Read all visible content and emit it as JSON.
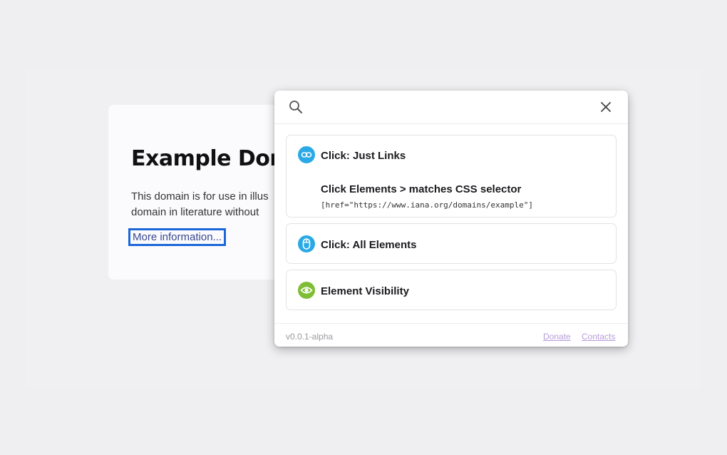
{
  "background_page": {
    "title": "Example Dom",
    "paragraph_lines": [
      "This domain is for use in illus",
      "domain in literature without"
    ],
    "link_label": "More information..."
  },
  "popup": {
    "search": {
      "placeholder": "",
      "value": ""
    },
    "actions": [
      {
        "label": "Click: Just Links",
        "icon": "link-icon",
        "icon_color": "#29a9e6",
        "sub_item": {
          "title": "Click Elements > matches CSS selector",
          "selector": "[href=\"https://www.iana.org/domains/example\"]"
        }
      },
      {
        "label": "Click: All Elements",
        "icon": "mouse-icon",
        "icon_color": "#29a9e6"
      },
      {
        "label": "Element Visibility",
        "icon": "eye-icon",
        "icon_color": "#7fbd35"
      }
    ],
    "footer": {
      "version": "v0.0.1-alpha",
      "donate_label": "Donate",
      "contacts_label": "Contacts"
    }
  },
  "colors": {
    "focus_outline": "#1c67d8",
    "link_purple": "#b69bd9"
  }
}
